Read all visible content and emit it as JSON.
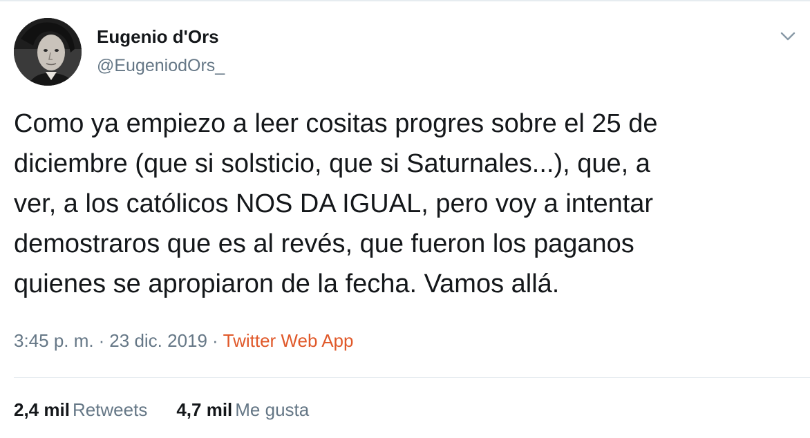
{
  "tweet": {
    "author": {
      "display_name": "Eugenio d'Ors",
      "handle": "@EugeniodOrs_"
    },
    "text_lines": [
      "Como ya empiezo a leer cositas progres sobre el 25 de",
      "diciembre (que si solsticio, que si Saturnales...), que, a",
      "ver, a los católicos NOS DA IGUAL, pero voy a intentar",
      "demostraros que es al revés, que fueron los paganos",
      "quienes se apropiaron de la fecha. Vamos allá."
    ],
    "meta": {
      "time": "3:45 p. m.",
      "separator": "·",
      "date": "23 dic. 2019",
      "source": "Twitter Web App"
    },
    "stats": {
      "retweets_count": "2,4 mil",
      "retweets_label": "Retweets",
      "likes_count": "4,7 mil",
      "likes_label": "Me gusta"
    }
  },
  "icons": {
    "menu": "chevron-down-icon"
  },
  "colors": {
    "text": "#14171a",
    "secondary": "#657786",
    "source_link": "#e0592a",
    "divider": "#e6ecf0"
  }
}
